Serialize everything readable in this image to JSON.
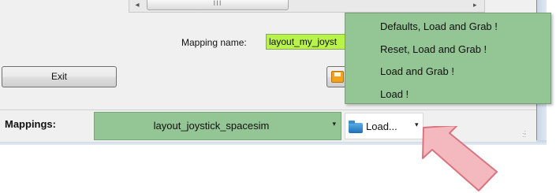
{
  "mapping_name": {
    "label": "Mapping name:",
    "value": "layout_my_joyst"
  },
  "scrollbar": {
    "thumb_grip": "III",
    "left_arrow": "◂",
    "right_arrow": "▸"
  },
  "buttons": {
    "exit": "Exit",
    "save_icon": "save-disk-icon"
  },
  "toolbar": {
    "mappings_label": "Mappings:",
    "mapping_selected": "layout_joystick_spacesim",
    "load_label": "Load...",
    "dropdown_arrow": "▾"
  },
  "load_menu": {
    "items": [
      "Defaults, Load and Grab !",
      "Reset, Load and Grab !",
      "Load and Grab !",
      "Load !"
    ]
  },
  "colors": {
    "menu_bg": "#94c594",
    "mapping_field_bg": "#b7f34a",
    "arrow_fill": "#f4b8bf",
    "arrow_stroke": "#d9737f"
  },
  "annotation": {
    "icon": "pink-arrow-pointer-icon"
  }
}
